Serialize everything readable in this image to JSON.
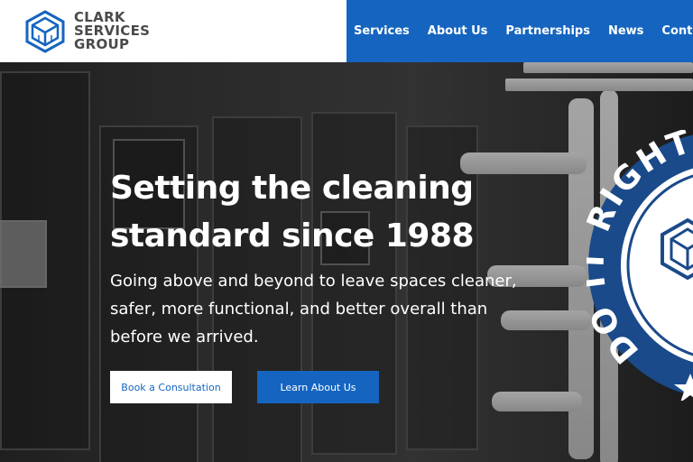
{
  "header": {
    "logo_lines": [
      "CLARK",
      "SERVICES",
      "GROUP"
    ],
    "nav": [
      "Services",
      "About Us",
      "Partnerships",
      "News",
      "Contact"
    ]
  },
  "hero": {
    "title": "Setting the cleaning standard since 1988",
    "subtitle": "Going above and beyond to leave spaces cleaner, safer, more functional, and better overall than before we arrived.",
    "primary_button": "Book a Consultation",
    "secondary_button": "Learn About Us",
    "badge_text": "DO IT RIGHT"
  },
  "colors": {
    "brand_blue": "#1565c0",
    "badge_navy": "#1a4a8a",
    "logo_gray": "#4a4a4a"
  }
}
